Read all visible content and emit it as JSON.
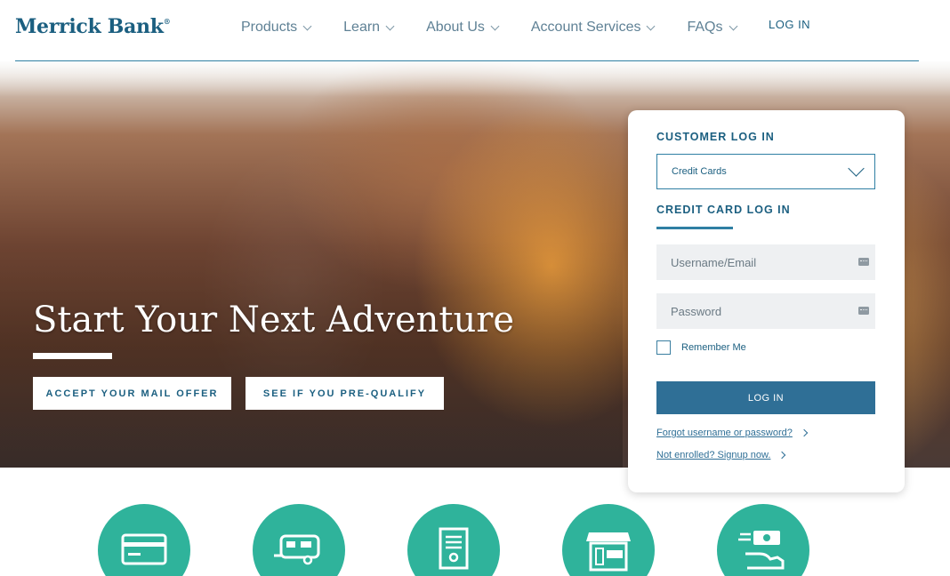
{
  "header": {
    "logo_text": "Merrick Bank",
    "logo_mark": "®",
    "nav": [
      {
        "label": "Products"
      },
      {
        "label": "Learn"
      },
      {
        "label": "About Us"
      },
      {
        "label": "Account Services"
      },
      {
        "label": "FAQs"
      }
    ],
    "login_label": "LOG IN"
  },
  "hero": {
    "title": "Start Your Next Adventure",
    "buttons": {
      "mail_offer": "ACCEPT YOUR MAIL OFFER",
      "prequalify": "SEE IF YOU PRE-QUALIFY"
    }
  },
  "login_card": {
    "heading": "CUSTOMER LOG IN",
    "product_select_value": "Credit Cards",
    "subheading": "CREDIT CARD LOG IN",
    "username_placeholder": "Username/Email",
    "password_placeholder": "Password",
    "remember_label": "Remember Me",
    "remember_checked": false,
    "login_button": "LOG IN",
    "forgot_link": "Forgot username or password?",
    "enroll_link": "Not enrolled? Signup now."
  },
  "product_icons": [
    {
      "icon": "credit-card-icon"
    },
    {
      "icon": "rv-camper-icon"
    },
    {
      "icon": "certificate-icon"
    },
    {
      "icon": "storefront-open-icon"
    },
    {
      "icon": "cash-hand-icon"
    }
  ],
  "colors": {
    "brand": "#1b5f80",
    "accent": "#2f6f96",
    "teal": "#2fb39b"
  }
}
